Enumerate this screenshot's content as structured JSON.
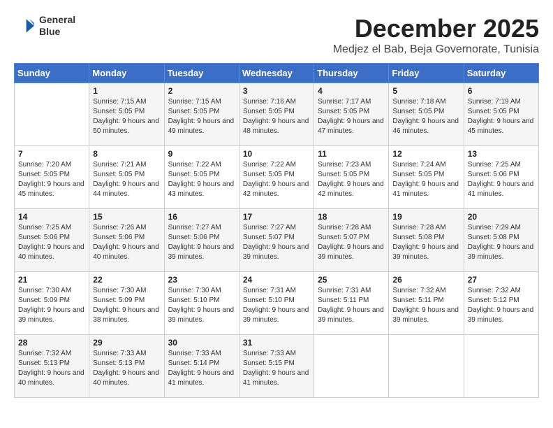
{
  "header": {
    "logo_line1": "General",
    "logo_line2": "Blue",
    "month": "December 2025",
    "location": "Medjez el Bab, Beja Governorate, Tunisia"
  },
  "calendar": {
    "days_of_week": [
      "Sunday",
      "Monday",
      "Tuesday",
      "Wednesday",
      "Thursday",
      "Friday",
      "Saturday"
    ],
    "weeks": [
      [
        {
          "day": "",
          "sunrise": "",
          "sunset": "",
          "daylight": ""
        },
        {
          "day": "1",
          "sunrise": "Sunrise: 7:15 AM",
          "sunset": "Sunset: 5:05 PM",
          "daylight": "Daylight: 9 hours and 50 minutes."
        },
        {
          "day": "2",
          "sunrise": "Sunrise: 7:15 AM",
          "sunset": "Sunset: 5:05 PM",
          "daylight": "Daylight: 9 hours and 49 minutes."
        },
        {
          "day": "3",
          "sunrise": "Sunrise: 7:16 AM",
          "sunset": "Sunset: 5:05 PM",
          "daylight": "Daylight: 9 hours and 48 minutes."
        },
        {
          "day": "4",
          "sunrise": "Sunrise: 7:17 AM",
          "sunset": "Sunset: 5:05 PM",
          "daylight": "Daylight: 9 hours and 47 minutes."
        },
        {
          "day": "5",
          "sunrise": "Sunrise: 7:18 AM",
          "sunset": "Sunset: 5:05 PM",
          "daylight": "Daylight: 9 hours and 46 minutes."
        },
        {
          "day": "6",
          "sunrise": "Sunrise: 7:19 AM",
          "sunset": "Sunset: 5:05 PM",
          "daylight": "Daylight: 9 hours and 45 minutes."
        }
      ],
      [
        {
          "day": "7",
          "sunrise": "Sunrise: 7:20 AM",
          "sunset": "Sunset: 5:05 PM",
          "daylight": "Daylight: 9 hours and 45 minutes."
        },
        {
          "day": "8",
          "sunrise": "Sunrise: 7:21 AM",
          "sunset": "Sunset: 5:05 PM",
          "daylight": "Daylight: 9 hours and 44 minutes."
        },
        {
          "day": "9",
          "sunrise": "Sunrise: 7:22 AM",
          "sunset": "Sunset: 5:05 PM",
          "daylight": "Daylight: 9 hours and 43 minutes."
        },
        {
          "day": "10",
          "sunrise": "Sunrise: 7:22 AM",
          "sunset": "Sunset: 5:05 PM",
          "daylight": "Daylight: 9 hours and 42 minutes."
        },
        {
          "day": "11",
          "sunrise": "Sunrise: 7:23 AM",
          "sunset": "Sunset: 5:05 PM",
          "daylight": "Daylight: 9 hours and 42 minutes."
        },
        {
          "day": "12",
          "sunrise": "Sunrise: 7:24 AM",
          "sunset": "Sunset: 5:05 PM",
          "daylight": "Daylight: 9 hours and 41 minutes."
        },
        {
          "day": "13",
          "sunrise": "Sunrise: 7:25 AM",
          "sunset": "Sunset: 5:06 PM",
          "daylight": "Daylight: 9 hours and 41 minutes."
        }
      ],
      [
        {
          "day": "14",
          "sunrise": "Sunrise: 7:25 AM",
          "sunset": "Sunset: 5:06 PM",
          "daylight": "Daylight: 9 hours and 40 minutes."
        },
        {
          "day": "15",
          "sunrise": "Sunrise: 7:26 AM",
          "sunset": "Sunset: 5:06 PM",
          "daylight": "Daylight: 9 hours and 40 minutes."
        },
        {
          "day": "16",
          "sunrise": "Sunrise: 7:27 AM",
          "sunset": "Sunset: 5:06 PM",
          "daylight": "Daylight: 9 hours and 39 minutes."
        },
        {
          "day": "17",
          "sunrise": "Sunrise: 7:27 AM",
          "sunset": "Sunset: 5:07 PM",
          "daylight": "Daylight: 9 hours and 39 minutes."
        },
        {
          "day": "18",
          "sunrise": "Sunrise: 7:28 AM",
          "sunset": "Sunset: 5:07 PM",
          "daylight": "Daylight: 9 hours and 39 minutes."
        },
        {
          "day": "19",
          "sunrise": "Sunrise: 7:28 AM",
          "sunset": "Sunset: 5:08 PM",
          "daylight": "Daylight: 9 hours and 39 minutes."
        },
        {
          "day": "20",
          "sunrise": "Sunrise: 7:29 AM",
          "sunset": "Sunset: 5:08 PM",
          "daylight": "Daylight: 9 hours and 39 minutes."
        }
      ],
      [
        {
          "day": "21",
          "sunrise": "Sunrise: 7:30 AM",
          "sunset": "Sunset: 5:09 PM",
          "daylight": "Daylight: 9 hours and 39 minutes."
        },
        {
          "day": "22",
          "sunrise": "Sunrise: 7:30 AM",
          "sunset": "Sunset: 5:09 PM",
          "daylight": "Daylight: 9 hours and 38 minutes."
        },
        {
          "day": "23",
          "sunrise": "Sunrise: 7:30 AM",
          "sunset": "Sunset: 5:10 PM",
          "daylight": "Daylight: 9 hours and 39 minutes."
        },
        {
          "day": "24",
          "sunrise": "Sunrise: 7:31 AM",
          "sunset": "Sunset: 5:10 PM",
          "daylight": "Daylight: 9 hours and 39 minutes."
        },
        {
          "day": "25",
          "sunrise": "Sunrise: 7:31 AM",
          "sunset": "Sunset: 5:11 PM",
          "daylight": "Daylight: 9 hours and 39 minutes."
        },
        {
          "day": "26",
          "sunrise": "Sunrise: 7:32 AM",
          "sunset": "Sunset: 5:11 PM",
          "daylight": "Daylight: 9 hours and 39 minutes."
        },
        {
          "day": "27",
          "sunrise": "Sunrise: 7:32 AM",
          "sunset": "Sunset: 5:12 PM",
          "daylight": "Daylight: 9 hours and 39 minutes."
        }
      ],
      [
        {
          "day": "28",
          "sunrise": "Sunrise: 7:32 AM",
          "sunset": "Sunset: 5:13 PM",
          "daylight": "Daylight: 9 hours and 40 minutes."
        },
        {
          "day": "29",
          "sunrise": "Sunrise: 7:33 AM",
          "sunset": "Sunset: 5:13 PM",
          "daylight": "Daylight: 9 hours and 40 minutes."
        },
        {
          "day": "30",
          "sunrise": "Sunrise: 7:33 AM",
          "sunset": "Sunset: 5:14 PM",
          "daylight": "Daylight: 9 hours and 41 minutes."
        },
        {
          "day": "31",
          "sunrise": "Sunrise: 7:33 AM",
          "sunset": "Sunset: 5:15 PM",
          "daylight": "Daylight: 9 hours and 41 minutes."
        },
        {
          "day": "",
          "sunrise": "",
          "sunset": "",
          "daylight": ""
        },
        {
          "day": "",
          "sunrise": "",
          "sunset": "",
          "daylight": ""
        },
        {
          "day": "",
          "sunrise": "",
          "sunset": "",
          "daylight": ""
        }
      ]
    ]
  }
}
